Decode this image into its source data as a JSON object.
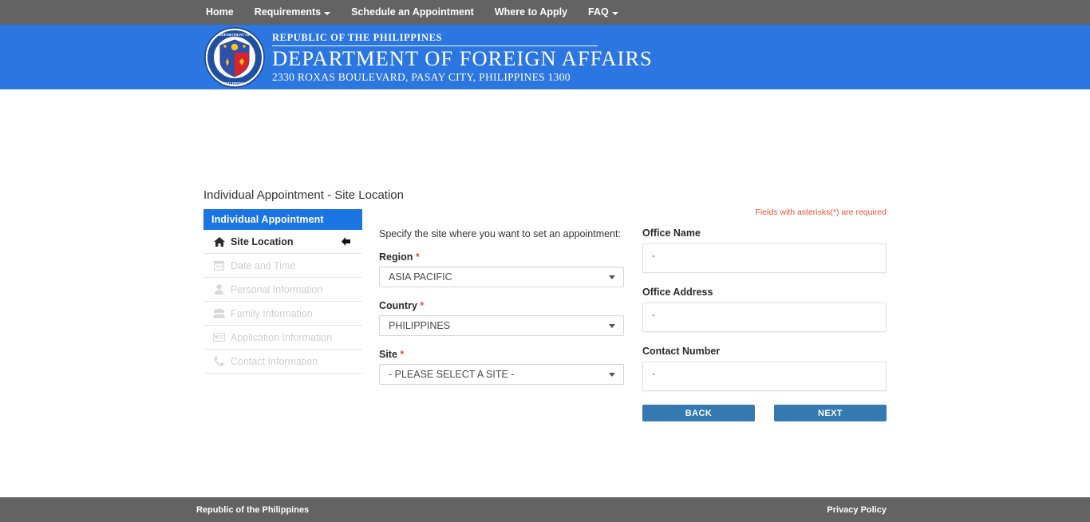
{
  "topnav": {
    "items": [
      {
        "label": "Home",
        "has_caret": false
      },
      {
        "label": "Requirements",
        "has_caret": true
      },
      {
        "label": "Schedule an Appointment",
        "has_caret": false
      },
      {
        "label": "Where to Apply",
        "has_caret": false
      },
      {
        "label": "FAQ",
        "has_caret": true
      }
    ]
  },
  "banner": {
    "line1": "REPUBLIC OF THE PHILIPPINES",
    "line2": "DEPARTMENT OF FOREIGN AFFAIRS",
    "line3": "2330 ROXAS BOULEVARD, PASAY CITY, PHILIPPINES 1300",
    "seal_top_text": "DEPARTMENT OF FOREIGN AFFAIRS",
    "seal_bottom_text": "PHILIPPINES",
    "bg_color": "#2b76e0"
  },
  "page": {
    "title": "Individual Appointment - Site Location"
  },
  "sidebar": {
    "header": "Individual Appointment",
    "header_color": "#1b74e4",
    "items": [
      {
        "label": "Site Location",
        "icon": "home-icon",
        "active": true,
        "arrow": "arrow-left-icon"
      },
      {
        "label": "Date and Time",
        "icon": "calendar-icon",
        "active": false
      },
      {
        "label": "Personal Information",
        "icon": "user-icon",
        "active": false
      },
      {
        "label": "Family Information",
        "icon": "family-icon",
        "active": false
      },
      {
        "label": "Application Information",
        "icon": "id-card-icon",
        "active": false
      },
      {
        "label": "Contact Information",
        "icon": "phone-icon",
        "active": false
      }
    ]
  },
  "form": {
    "instruction": "Specify the site where you want to set an appointment:",
    "fields": [
      {
        "label": "Region",
        "required": true,
        "value": "ASIA PACIFIC"
      },
      {
        "label": "Country",
        "required": true,
        "value": "PHILIPPINES"
      },
      {
        "label": "Site",
        "required": true,
        "value": "- PLEASE SELECT A SITE -"
      }
    ],
    "required_marker": "*"
  },
  "details": {
    "required_note": "Fields with asterisks(*) are required",
    "required_note_color": "#e8503a",
    "fields": [
      {
        "label": "Office Name",
        "value": "-"
      },
      {
        "label": "Office Address",
        "value": "-"
      },
      {
        "label": "Contact Number",
        "value": "-"
      }
    ],
    "back_label": "BACK",
    "next_label": "NEXT",
    "button_color": "#3479b0"
  },
  "footer": {
    "left": "Republic of the Philippines",
    "right": "Privacy Policy",
    "bg_color": "#636363"
  }
}
